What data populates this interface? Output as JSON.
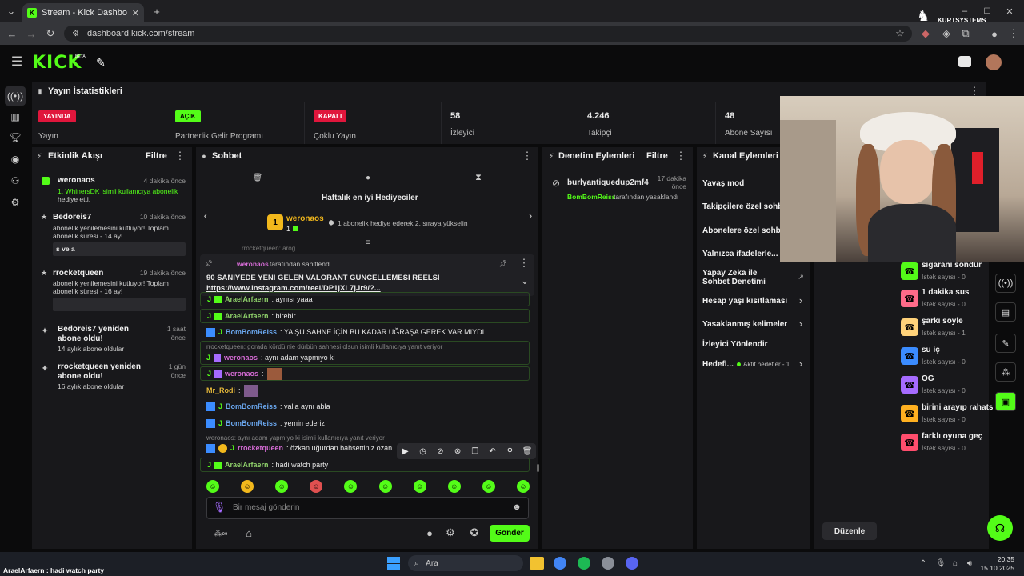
{
  "browser": {
    "tab_title": "Stream - Kick Dashboard",
    "url": "dashboard.kick.com/stream",
    "profile_name": "KURTSYSTEMS"
  },
  "kick": {
    "logo": "KICK",
    "logo_sup": "BETA"
  },
  "stats": {
    "title": "Yayın İstatistikleri",
    "cards": [
      {
        "badge": "YAYINDA",
        "label": "Yayın",
        "badge_color": "#e0163c"
      },
      {
        "badge": "AÇIK",
        "label": "Partnerlik Gelir Programı",
        "badge_color": "#53fc18"
      },
      {
        "badge": "KAPALI",
        "label": "Çoklu Yayın",
        "badge_color": "#e0163c"
      },
      {
        "value": "58",
        "label": "İzleyici"
      },
      {
        "value": "4.246",
        "label": "Takipçi"
      },
      {
        "value": "48",
        "label": "Abone Sayısı"
      }
    ]
  },
  "activity": {
    "title": "Etkinlik Akışı",
    "filter": "Filtre",
    "events": [
      {
        "name": "weronaos",
        "time": "4 dakika önce",
        "line1": "1, WhinersDK isimli kullanıcıya abonelik",
        "line2": "hediye etti."
      },
      {
        "name": "Bedoreis7",
        "time": "10 dakika önce",
        "line1": "abonelik yenilemesini kutluyor! Toplam",
        "line2": "abonelik süresi - 14 ay!",
        "msg": "s ve a"
      },
      {
        "name": "rrocketqueen",
        "time": "19 dakika önce",
        "line1": "abonelik yenilemesini kutluyor! Toplam",
        "line2": "abonelik süresi - 16 ay!"
      },
      {
        "name": "Bedoreis7 yeniden abone oldu!",
        "time": "1 saat önce",
        "line1": "14 aylık abone oldular"
      },
      {
        "name": "rrocketqueen yeniden abone oldu!",
        "time": "1 gün önce",
        "line1": "16 aylık abone oldular"
      }
    ]
  },
  "chat": {
    "title": "Sohbet",
    "gifters_title": "Haftalık en iyi Hediyeciler",
    "top_gifter": "weronaos",
    "top_gifter_count": "1",
    "top_gifter_rank": "1",
    "gifter_hint": "1 abonelik hediye ederek 2. sıraya yükselin",
    "pinned_by": "weronaos",
    "pinned_by_suffix": "tarafından sabitlendi",
    "pinned_text": "90 SANİYEDE YENİ GELEN VALORANT GÜNCELLEMESİ REELSI",
    "pinned_link": "https://www.instagram.com/reel/DP1jXL7jJr9/?...",
    "partial_top": "rrocketqueen: arog",
    "messages": [
      {
        "user": "AraelArfaern",
        "text": ": aynısı yaaa",
        "color": "#8ecf6a",
        "boxed": true
      },
      {
        "user": "AraelArfaern",
        "text": ": birebir",
        "color": "#8ecf6a",
        "boxed": true
      },
      {
        "user": "BomBomReiss",
        "text": ": YA ŞU SAHNE İÇİN BU KADAR UĞRAŞA GEREK VAR MIYDI",
        "color": "#6aa7ef",
        "boxed": false
      },
      {
        "reply": "rrocketqueen: gorada kördü nie dürbün sahnesi olsun isimli kullanıcıya yanıt veriyor",
        "user": "weronaos",
        "text": ": aynı adam yapmıyo ki",
        "color": "#d56bd5",
        "boxed": true
      },
      {
        "user": "weronaos",
        "text": ":",
        "color": "#d56bd5",
        "boxed": true,
        "emote": true
      },
      {
        "user": "Mr_Rodi",
        "text": ":",
        "color": "#e5b83a",
        "boxed": false,
        "emote": true
      },
      {
        "user": "BomBomReiss",
        "text": ": valla aynı abla",
        "color": "#6aa7ef",
        "boxed": false
      },
      {
        "user": "BomBomReiss",
        "text": ": yemin ederiz",
        "color": "#6aa7ef",
        "boxed": false
      },
      {
        "reply": "weronaos: aynı adam yapmıyo ki isimli kullanıcıya yanıt veriyor",
        "user": "rrocketqueen",
        "text": ": özkan uğurdan bahsettiniz ozan",
        "color": "#d56bd5",
        "boxed": false
      },
      {
        "user": "AraelArfaern",
        "text": ": hadi watch party",
        "color": "#8ecf6a",
        "boxed": true
      }
    ],
    "input_placeholder": "Bir mesaj gönderin",
    "send_label": "Gönder"
  },
  "moderation": {
    "title": "Denetim Eylemleri",
    "filter": "Filtre",
    "entry_user": "burlyantiquedup2mf4",
    "entry_time": "17 dakika önce",
    "entry_actor": "BomBomReiss",
    "entry_action": "tarafından yasaklandı"
  },
  "channel_actions": {
    "title": "Kanal Eylemleri",
    "items": [
      "Yavaş mod",
      "Takipçilere özel sohbet",
      "Abonelere özel sohbet",
      "Yalnızca ifadelerle...",
      "Yapay Zeka ile Sohbet Denetimi",
      "Hesap yaşı kısıtlaması",
      "Yasaklanmış kelimeler",
      "İzleyici Yönlendir",
      "Hedefl..."
    ],
    "goal_status": "Aktif hedefler - 1"
  },
  "rewards": {
    "items": [
      {
        "title": "sigaranı söndür",
        "sub": "İstek sayısı - 0",
        "color": "#53fc18"
      },
      {
        "title": "1 dakika sus",
        "sub": "İstek sayısı - 0",
        "color": "#ff6b8a"
      },
      {
        "title": "şarkı söyle",
        "sub": "İstek sayısı - 1",
        "color": "#ffd27a"
      },
      {
        "title": "su iç",
        "sub": "İstek sayısı - 0",
        "color": "#3b8cff"
      },
      {
        "title": "OG",
        "sub": "İstek sayısı - 0",
        "color": "#a66bff"
      },
      {
        "title": "birini arayıp rahats",
        "sub": "İstek sayısı - 0",
        "color": "#ffb020"
      },
      {
        "title": "farklı oyuna geç",
        "sub": "İstek sayısı - 0",
        "color": "#ff4d6d"
      }
    ],
    "edit_label": "Düzenle"
  },
  "taskbar": {
    "search": "Ara",
    "time": "20:35",
    "date": "15.10.2025",
    "overlay_text": "AraelArfaern : hadi watch party"
  }
}
